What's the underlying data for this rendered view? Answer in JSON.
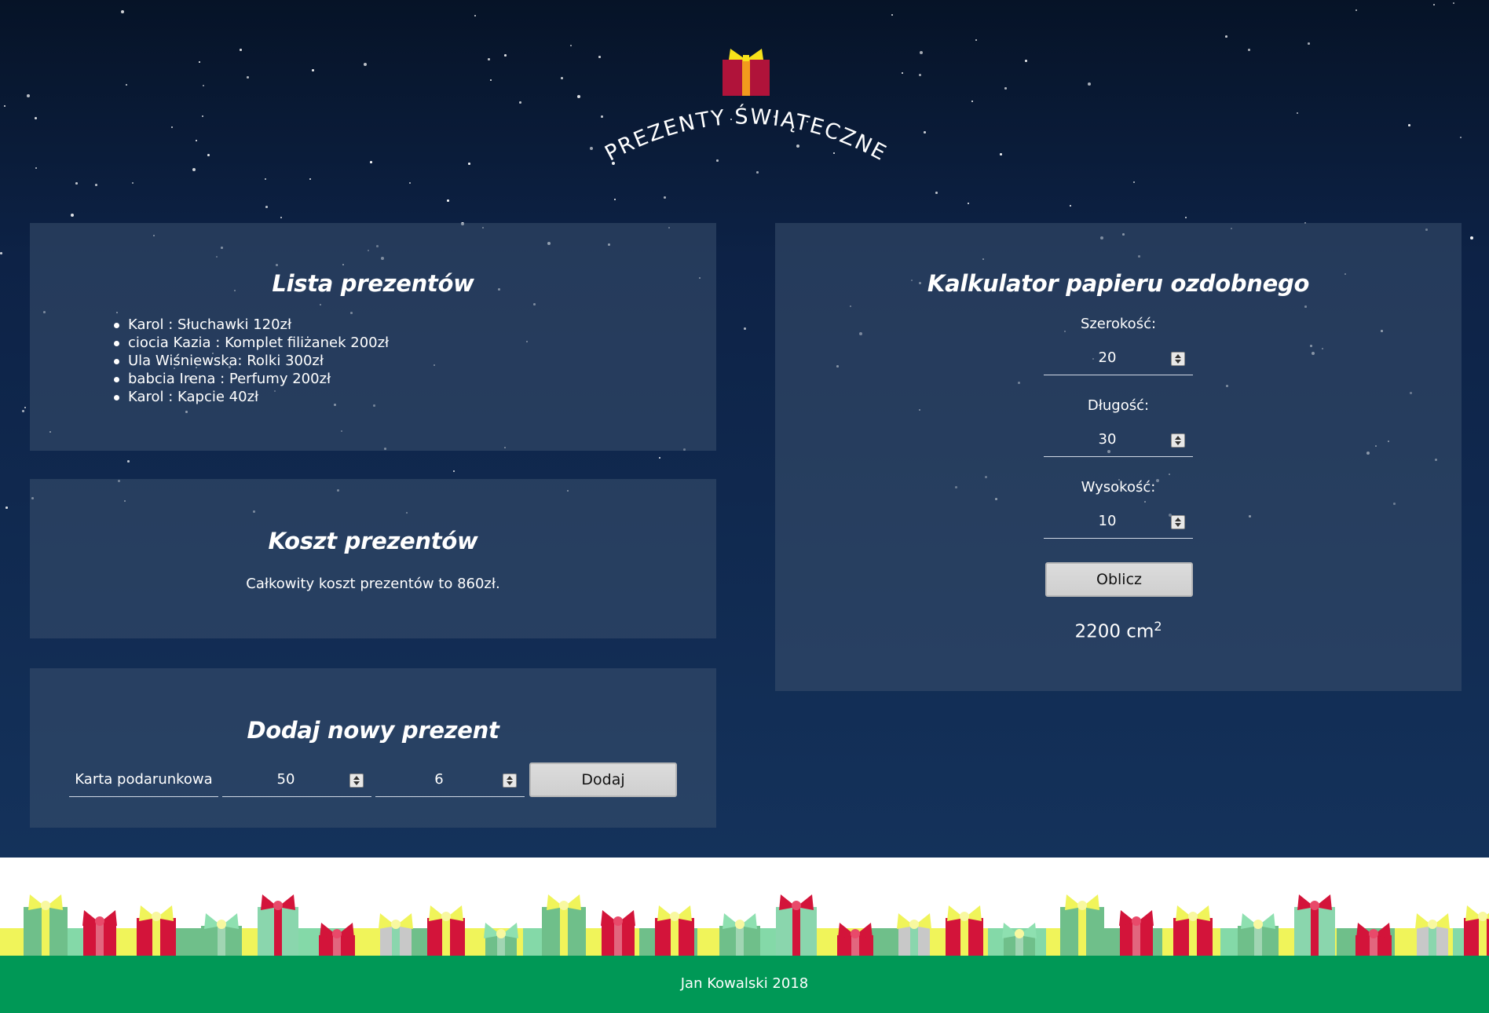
{
  "header": {
    "title": "PREZENTY ŚWIĄTECZNE",
    "logo_icon": "gift-icon"
  },
  "gift_list": {
    "title": "Lista prezentów",
    "items": [
      "Karol : Słuchawki 120zł",
      "ciocia Kazia : Komplet filiżanek 200zł",
      "Ula Wiśniewska: Rolki 300zł",
      "babcia Irena : Perfumy 200zł",
      "Karol : Kapcie 40zł"
    ]
  },
  "cost": {
    "title": "Koszt prezentów",
    "text": "Całkowity koszt prezentów to 860zł."
  },
  "add_gift": {
    "title": "Dodaj nowy prezent",
    "name_value": "Karta podarunkowa",
    "price_value": "50",
    "person_value": "6",
    "button_label": "Dodaj"
  },
  "calculator": {
    "title": "Kalkulator papieru ozdobnego",
    "width_label": "Szerokość:",
    "width_value": "20",
    "length_label": "Długość:",
    "length_value": "30",
    "height_label": "Wysokość:",
    "height_value": "10",
    "button_label": "Oblicz",
    "result_value": "2200 cm",
    "result_exponent": "2"
  },
  "footer": {
    "text": "Jan Kowalski 2018"
  },
  "colors": {
    "sky_top": "#061327",
    "sky_bottom": "#14325b",
    "footer_green": "#009856",
    "gift_red": "#d3143a",
    "gift_yellow": "#f0f45a",
    "gift_green": "#6fbf8a"
  }
}
